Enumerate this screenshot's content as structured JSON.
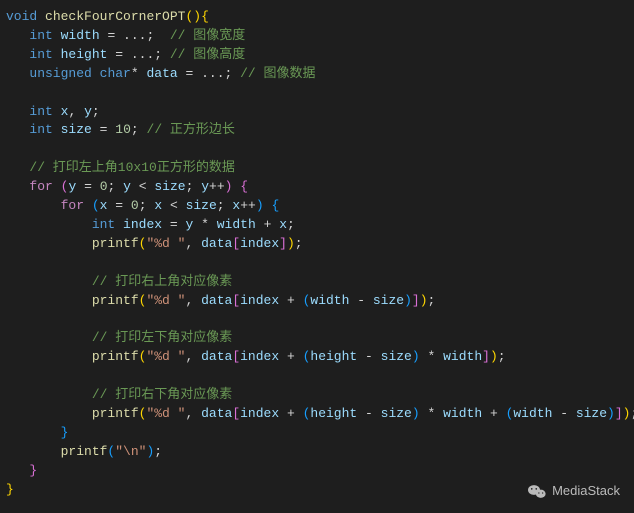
{
  "code": {
    "fn_decl_kw": "void",
    "fn_name": "checkFourCornerOPT",
    "l2_kw": "int",
    "l2_var": "width",
    "l2_rest": " = ...;  ",
    "l2_cmt": "// 图像宽度",
    "l3_kw": "int",
    "l3_var": "height",
    "l3_rest": " = ...; ",
    "l3_cmt": "// 图像高度",
    "l4_kw1": "unsigned",
    "l4_kw2": "char",
    "l4_var": "data",
    "l4_rest": " = ...; ",
    "l4_cmt": "// 图像数据",
    "l6_kw": "int",
    "l6_v1": "x",
    "l6_v2": "y",
    "l7_kw": "int",
    "l7_var": "size",
    "l7_num": "10",
    "l7_cmt": "// 正方形边长",
    "l9_cmt": "// 打印左上角10x10正方形的数据",
    "for_kw": "for",
    "f1_v": "y",
    "f1_n": "0",
    "f1_size": "size",
    "f2_v": "x",
    "f2_n": "0",
    "f2_size": "size",
    "idx_kw": "int",
    "idx_var": "index",
    "idx_y": "y",
    "idx_w": "width",
    "idx_x": "x",
    "printf": "printf",
    "fmt": "\"%d \"",
    "data_var": "data",
    "index_var": "index",
    "width_var": "width",
    "height_var": "height",
    "size_var": "size",
    "cmt_tr": "// 打印右上角对应像素",
    "cmt_bl": "// 打印左下角对应像素",
    "cmt_br": "// 打印右下角对应像素",
    "nl_str": "\"\\n\"",
    "op_star": "*",
    "op_plus": "+",
    "op_minus": "-",
    "op_inc": "++",
    "op_lt": "<",
    "op_eq": "=",
    "semi": ";",
    "comma": ",",
    "lp": "(",
    "rp": ")",
    "lb": "[",
    "rb": "]",
    "lc": "{",
    "rc": "}"
  },
  "watermark": {
    "text": "MediaStack"
  }
}
